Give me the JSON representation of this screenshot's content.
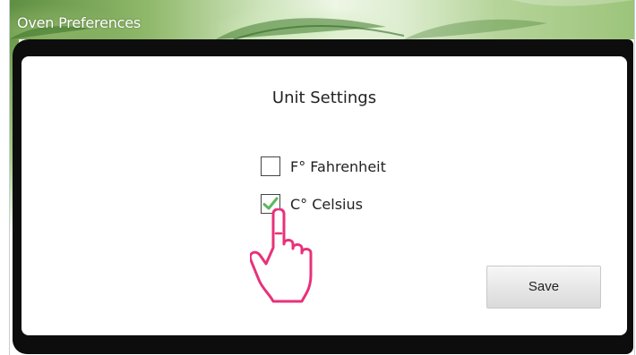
{
  "window": {
    "title": "Oven Preferences"
  },
  "dialog": {
    "heading": "Unit Settings",
    "options": [
      {
        "label": "F° Fahrenheit",
        "checked": false
      },
      {
        "label": "C° Celsius",
        "checked": true
      }
    ],
    "save_label": "Save"
  },
  "colors": {
    "dialog_border": "#0d0d0d",
    "checkmark": "#5cb85c",
    "cursor": "#e8317a",
    "title_bar_leaf": "#8fb86a"
  },
  "icons": {
    "checkmark": "check-icon",
    "cursor": "hand-pointer-icon"
  }
}
